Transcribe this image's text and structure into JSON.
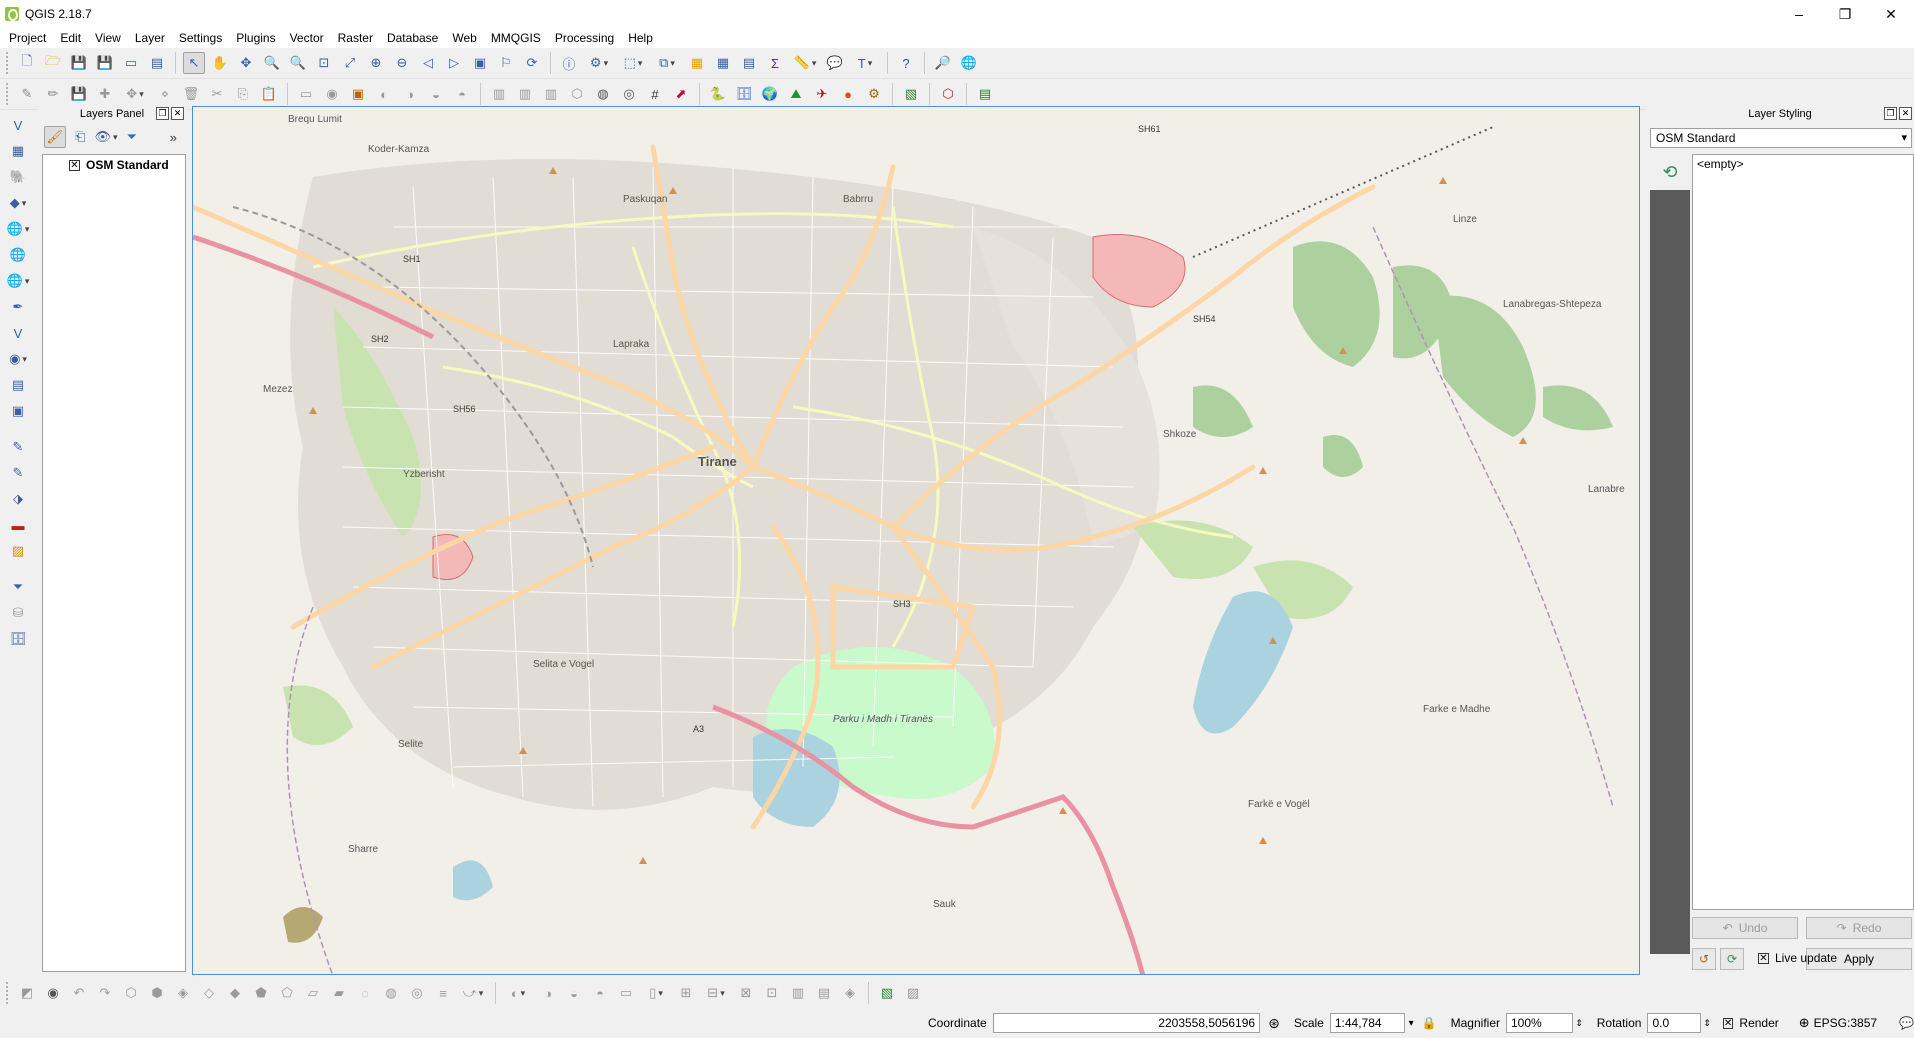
{
  "window": {
    "title": "QGIS 2.18.7",
    "controls": [
      "–",
      "❐",
      "✕"
    ]
  },
  "menu": [
    "Project",
    "Edit",
    "View",
    "Layer",
    "Settings",
    "Plugins",
    "Vector",
    "Raster",
    "Database",
    "Web",
    "MMQGIS",
    "Processing",
    "Help"
  ],
  "layers_panel": {
    "title": "Layers Panel",
    "layers": [
      {
        "name": "OSM Standard",
        "checked": true
      }
    ]
  },
  "layer_styling": {
    "title": "Layer Styling",
    "selected_layer": "OSM Standard",
    "renderer": "<empty>",
    "undo_label": "Undo",
    "redo_label": "Redo",
    "live_update_label": "Live update",
    "live_update_checked": true,
    "apply_label": "Apply"
  },
  "map": {
    "labels": [
      {
        "text": "Tirane",
        "cls": "city"
      },
      {
        "text": "Koder-Kamza"
      },
      {
        "text": "Paskuqan"
      },
      {
        "text": "Babrru"
      },
      {
        "text": "Lapraka"
      },
      {
        "text": "Mezez"
      },
      {
        "text": "Yzberisht"
      },
      {
        "text": "Selita e Vogel"
      },
      {
        "text": "Selite"
      },
      {
        "text": "Sharre"
      },
      {
        "text": "Sauk"
      },
      {
        "text": "Shkoze"
      },
      {
        "text": "Linze"
      },
      {
        "text": "Farke e Madhe"
      },
      {
        "text": "Farkë e Vogël"
      },
      {
        "text": "Lanabregas-Shtepeza"
      },
      {
        "text": "Parku i Madh i Tiranës"
      },
      {
        "text": "Brequ Lumit"
      },
      {
        "text": "Lanabre"
      }
    ],
    "roads": [
      "SH1",
      "SH2",
      "SH3",
      "SH54",
      "SH56",
      "SH61",
      "A3"
    ]
  },
  "status": {
    "coordinate_label": "Coordinate",
    "coordinate_value": "2203558,5056196",
    "scale_label": "Scale",
    "scale_value": "1:44,784",
    "magnifier_label": "Magnifier",
    "magnifier_value": "100%",
    "rotation_label": "Rotation",
    "rotation_value": "0.0",
    "render_label": "Render",
    "render_checked": true,
    "crs": "EPSG:3857"
  }
}
